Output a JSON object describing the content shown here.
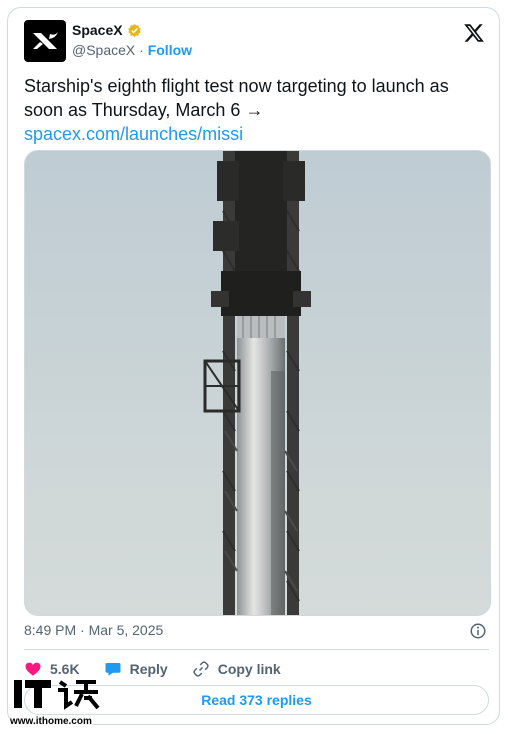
{
  "author": {
    "display_name": "SpaceX",
    "handle": "@SpaceX",
    "separator": " · ",
    "follow_label": "Follow",
    "verified_color": "#e2b719",
    "avatar_icon": "spacex-x-logo-icon"
  },
  "platform_icon": "x-logo-icon",
  "tweet": {
    "text": "Starship's eighth flight test now targeting to launch as soon as Thursday, March 6 → ",
    "link_text": "spacex.com/launches/missi",
    "ellipsis": "…"
  },
  "media": {
    "subject": "Starship on launch tower"
  },
  "timestamp": "8:49 PM · Mar 5, 2025",
  "actions": {
    "likes": "5.6K",
    "reply_label": "Reply",
    "copy_label": "Copy link"
  },
  "read_replies_label": "Read 373 replies",
  "watermark": {
    "logo": "IT之家",
    "url": "www.ithome.com"
  },
  "colors": {
    "accent": "#1d9bf0",
    "like": "#f91880",
    "text": "#0f1419",
    "secondary": "#536471"
  }
}
